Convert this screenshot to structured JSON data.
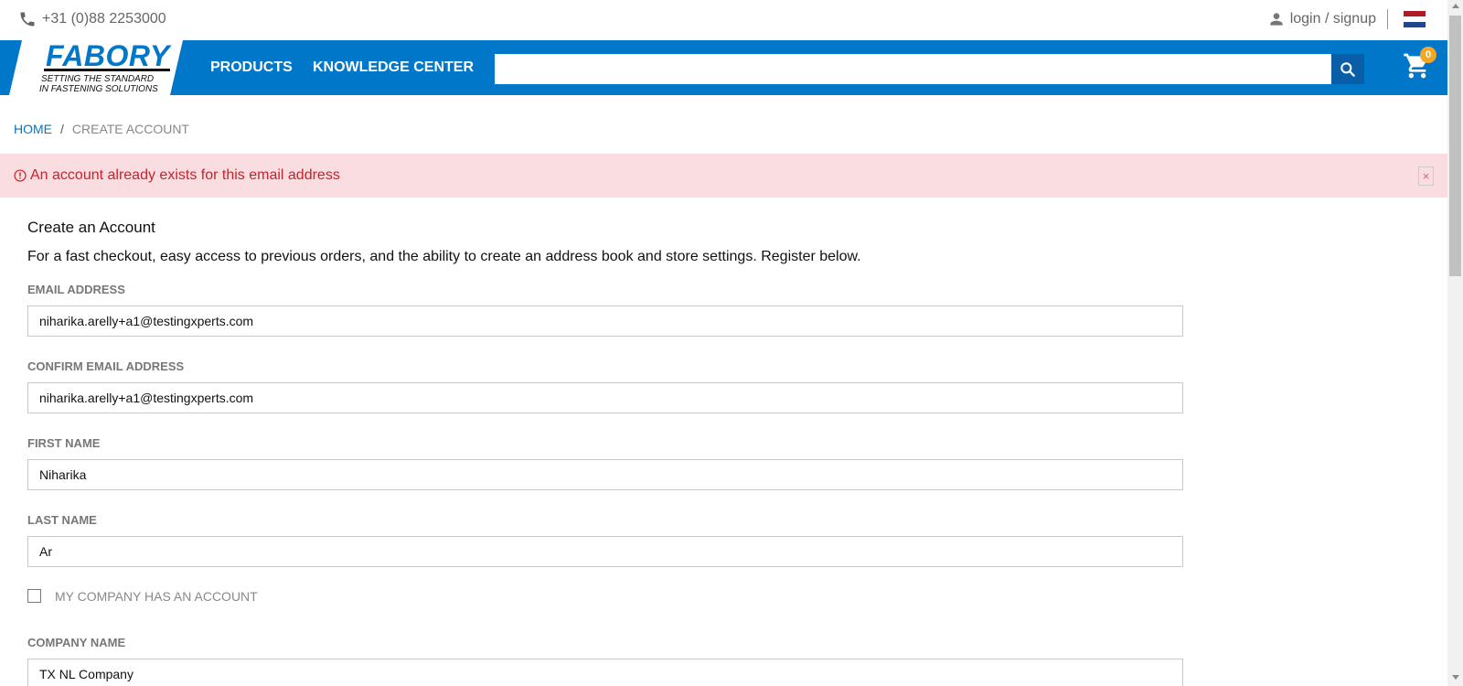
{
  "topbar": {
    "phone_icon": "phone-icon",
    "phone": "+31 (0)88 2253000",
    "login_icon": "user-icon",
    "login": "login / signup",
    "flag": {
      "name": "netherlands-flag",
      "colors": [
        "#ae1c28",
        "#ffffff",
        "#21468b"
      ]
    }
  },
  "header": {
    "logo": {
      "name": "FABORY",
      "tagline_1": "SETTING THE STANDARD",
      "tagline_2": "IN FASTENING SOLUTIONS"
    },
    "nav": {
      "products": "PRODUCTS",
      "knowledge": "KNOWLEDGE CENTER"
    },
    "search": {
      "placeholder": "",
      "icon": "search-icon"
    },
    "cart": {
      "icon": "cart-icon",
      "count": "0"
    },
    "colors": {
      "primary": "#0077c8",
      "search_button": "#0a5ea8",
      "badge": "#f5a623"
    }
  },
  "breadcrumb": {
    "home": "HOME",
    "separator": "/",
    "current": "CREATE ACCOUNT"
  },
  "alert": {
    "icon": "exclamation-circle-icon",
    "message": "An account already exists for this email address",
    "close": "×",
    "colors": {
      "background": "#f9dde0",
      "text": "#c8232c"
    }
  },
  "form": {
    "title": "Create an Account",
    "description": "For a fast checkout, easy access to previous orders, and the ability to create an address book and store settings. Register below.",
    "email": {
      "label": "EMAIL ADDRESS",
      "value": "niharika.arelly+a1@testingxperts.com"
    },
    "confirm_email": {
      "label": "CONFIRM EMAIL ADDRESS",
      "value": "niharika.arelly+a1@testingxperts.com"
    },
    "first_name": {
      "label": "FIRST NAME",
      "value": "Niharika"
    },
    "last_name": {
      "label": "LAST NAME",
      "value": "Ar"
    },
    "company_account": {
      "label": "MY COMPANY HAS AN ACCOUNT",
      "checked": false
    },
    "company_name": {
      "label": "COMPANY NAME",
      "value": "TX NL Company"
    }
  }
}
